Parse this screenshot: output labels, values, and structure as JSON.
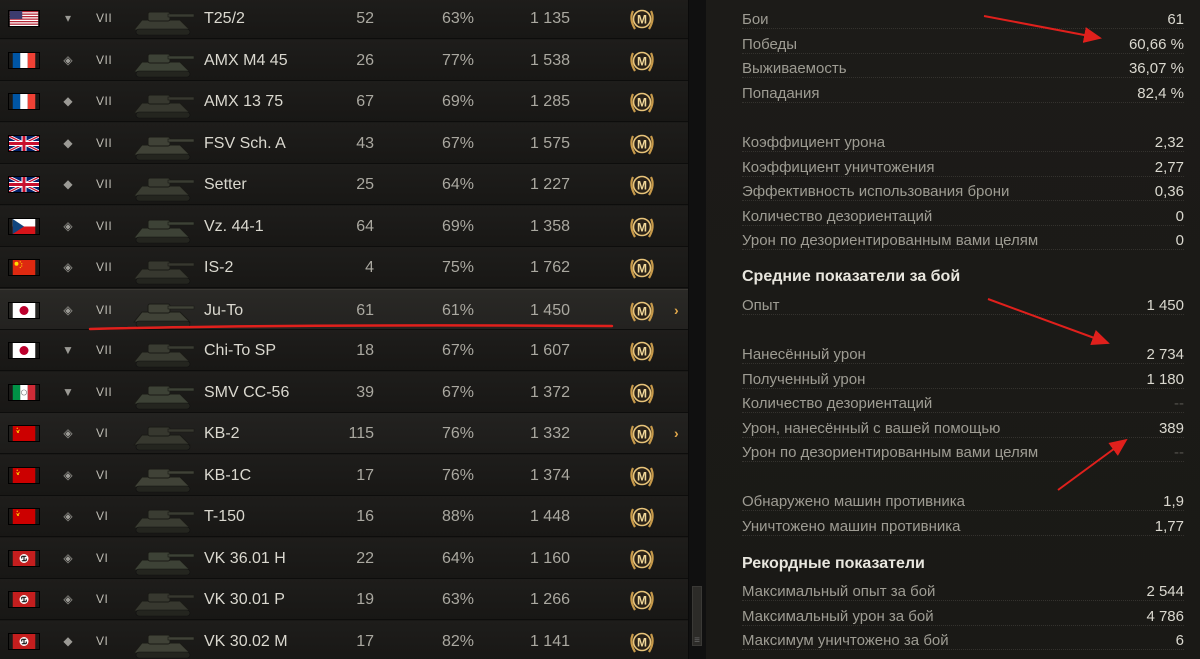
{
  "vehicles": [
    {
      "flag": "usa",
      "class": "medium",
      "tier": "VII",
      "name": "T25/2",
      "battles": "52",
      "winrate": "63%",
      "avg_xp": "1 135",
      "mastery": "M",
      "state": "normal",
      "arrow": ""
    },
    {
      "flag": "france",
      "class": "heavy",
      "tier": "VII",
      "name": "AMX M4 45",
      "battles": "26",
      "winrate": "77%",
      "avg_xp": "1 538",
      "mastery": "M",
      "state": "normal",
      "arrow": ""
    },
    {
      "flag": "france",
      "class": "light",
      "tier": "VII",
      "name": "AMX 13 75",
      "battles": "67",
      "winrate": "69%",
      "avg_xp": "1 285",
      "mastery": "M",
      "state": "normal",
      "arrow": ""
    },
    {
      "flag": "uk",
      "class": "light",
      "tier": "VII",
      "name": "FSV Sch. A",
      "battles": "43",
      "winrate": "67%",
      "avg_xp": "1 575",
      "mastery": "M",
      "state": "normal",
      "arrow": ""
    },
    {
      "flag": "uk",
      "class": "light",
      "tier": "VII",
      "name": "Setter",
      "battles": "25",
      "winrate": "64%",
      "avg_xp": "1 227",
      "mastery": "M",
      "state": "normal",
      "arrow": ""
    },
    {
      "flag": "czech",
      "class": "heavy",
      "tier": "VII",
      "name": "Vz. 44-1",
      "battles": "64",
      "winrate": "69%",
      "avg_xp": "1 358",
      "mastery": "M",
      "state": "normal",
      "arrow": ""
    },
    {
      "flag": "china",
      "class": "heavy",
      "tier": "VII",
      "name": "IS-2",
      "battles": "4",
      "winrate": "75%",
      "avg_xp": "1 762",
      "mastery": "M",
      "state": "normal",
      "arrow": ""
    },
    {
      "flag": "japan",
      "class": "heavy",
      "tier": "VII",
      "name": "Ju-To",
      "battles": "61",
      "winrate": "61%",
      "avg_xp": "1 450",
      "mastery": "M",
      "state": "selected",
      "arrow": "›"
    },
    {
      "flag": "japan",
      "class": "td",
      "tier": "VII",
      "name": "Chi-To SP",
      "battles": "18",
      "winrate": "67%",
      "avg_xp": "1 607",
      "mastery": "M",
      "state": "normal",
      "arrow": ""
    },
    {
      "flag": "italy",
      "class": "td",
      "tier": "VII",
      "name": "SMV CC-56",
      "battles": "39",
      "winrate": "67%",
      "avg_xp": "1 372",
      "mastery": "M",
      "state": "normal",
      "arrow": ""
    },
    {
      "flag": "ussr",
      "class": "heavy",
      "tier": "VI",
      "name": "KB-2",
      "battles": "115",
      "winrate": "76%",
      "avg_xp": "1 332",
      "mastery": "M",
      "state": "hover",
      "arrow": "›"
    },
    {
      "flag": "ussr",
      "class": "heavy",
      "tier": "VI",
      "name": "KB-1C",
      "battles": "17",
      "winrate": "76%",
      "avg_xp": "1 374",
      "mastery": "M",
      "state": "normal",
      "arrow": ""
    },
    {
      "flag": "ussr",
      "class": "heavy",
      "tier": "VI",
      "name": "T-150",
      "battles": "16",
      "winrate": "88%",
      "avg_xp": "1 448",
      "mastery": "M",
      "state": "normal",
      "arrow": ""
    },
    {
      "flag": "germany",
      "class": "heavy",
      "tier": "VI",
      "name": "VK 36.01 H",
      "battles": "22",
      "winrate": "64%",
      "avg_xp": "1 160",
      "mastery": "M",
      "state": "normal",
      "arrow": ""
    },
    {
      "flag": "germany",
      "class": "heavy",
      "tier": "VI",
      "name": "VK 30.01 P",
      "battles": "19",
      "winrate": "63%",
      "avg_xp": "1 266",
      "mastery": "M",
      "state": "normal",
      "arrow": ""
    },
    {
      "flag": "germany",
      "class": "light",
      "tier": "VI",
      "name": "VK 30.02 M",
      "battles": "17",
      "winrate": "82%",
      "avg_xp": "1 141",
      "mastery": "M",
      "state": "normal",
      "arrow": ""
    }
  ],
  "stats": {
    "general": [
      {
        "label": "Бои",
        "value": "61"
      },
      {
        "label": "Победы",
        "value": "60,66 %"
      },
      {
        "label": "Выживаемость",
        "value": "36,07 %"
      },
      {
        "label": "Попадания",
        "value": "82,4 %"
      }
    ],
    "ratios": [
      {
        "label": "Коэффициент урона",
        "value": "2,32"
      },
      {
        "label": "Коэффициент уничтожения",
        "value": "2,77"
      },
      {
        "label": "Эффективность использования брони",
        "value": "0,36"
      },
      {
        "label": "Количество дезориентаций",
        "value": "0"
      },
      {
        "label": "Урон по дезориентированным вами целям",
        "value": "0"
      }
    ],
    "average_title": "Средние показатели за бой",
    "average_xp": [
      {
        "label": "Опыт",
        "value": "1 450"
      }
    ],
    "average_damage": [
      {
        "label": "Нанесённый урон",
        "value": "2 734"
      },
      {
        "label": "Полученный урон",
        "value": "1 180"
      },
      {
        "label": "Количество дезориентаций",
        "value": "--"
      },
      {
        "label": "Урон, нанесённый с вашей помощью",
        "value": "389"
      },
      {
        "label": "Урон по дезориентированным вами целям",
        "value": "--"
      }
    ],
    "average_spotting": [
      {
        "label": "Обнаружено машин противника",
        "value": "1,9"
      },
      {
        "label": "Уничтожено машин противника",
        "value": "1,77"
      }
    ],
    "records_title": "Рекордные показатели",
    "records": [
      {
        "label": "Максимальный опыт за бой",
        "value": "2 544"
      },
      {
        "label": "Максимальный урон за бой",
        "value": "4 786"
      },
      {
        "label": "Максимум уничтожено за бой",
        "value": "6"
      }
    ]
  },
  "colors": {
    "annotation": "#e0201c",
    "accent": "#e2a84b"
  }
}
